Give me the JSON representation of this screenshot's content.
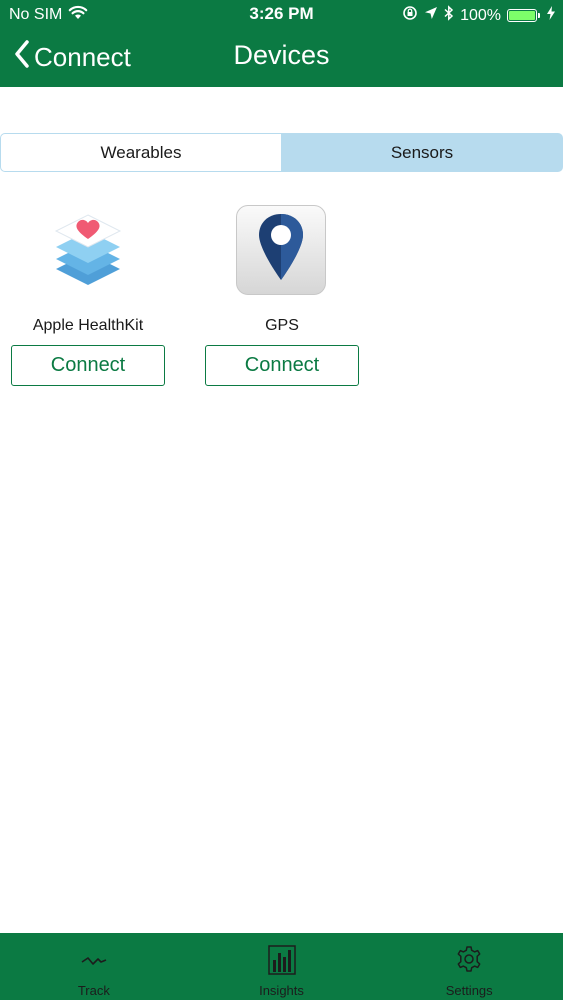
{
  "colors": {
    "green": "#0b7a43",
    "segment_selected": "#b7dbee"
  },
  "status_bar": {
    "carrier": "No SIM",
    "time": "3:26 PM",
    "battery": "100%",
    "icons": [
      "wifi-icon",
      "orientation-lock-icon",
      "location-icon",
      "bluetooth-icon",
      "battery-icon",
      "charging-icon"
    ]
  },
  "nav": {
    "back_label": "Connect",
    "title": "Devices"
  },
  "segments": {
    "wearables": "Wearables",
    "sensors": "Sensors",
    "selected": "Sensors"
  },
  "devices": [
    {
      "name": "Apple HealthKit",
      "button": "Connect",
      "icon": "healthkit-icon"
    },
    {
      "name": "GPS",
      "button": "Connect",
      "icon": "gps-pin-icon"
    }
  ],
  "tabbar": {
    "items": [
      {
        "label": "Track",
        "icon": "pulse-icon"
      },
      {
        "label": "Insights",
        "icon": "bar-chart-icon"
      },
      {
        "label": "Settings",
        "icon": "gear-icon"
      }
    ]
  }
}
